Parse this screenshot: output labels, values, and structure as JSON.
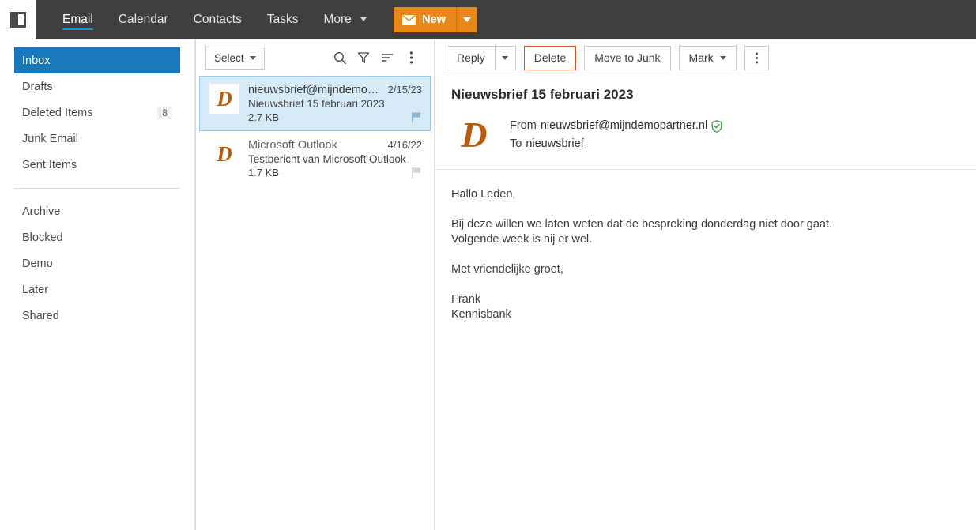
{
  "topbar": {
    "toggle_name": "sidebar-toggle",
    "nav_items": [
      {
        "label": "Email",
        "active": true,
        "has_caret": false
      },
      {
        "label": "Calendar",
        "active": false,
        "has_caret": false
      },
      {
        "label": "Contacts",
        "active": false,
        "has_caret": false
      },
      {
        "label": "Tasks",
        "active": false,
        "has_caret": false
      },
      {
        "label": "More",
        "active": false,
        "has_caret": true
      }
    ],
    "new_button": {
      "label": "New",
      "icon": "envelope-icon",
      "color": "#e8881a"
    }
  },
  "sidebar": {
    "folders": [
      {
        "label": "Inbox",
        "count": "",
        "selected": true
      },
      {
        "label": "Drafts",
        "count": "",
        "selected": false
      },
      {
        "label": "Deleted Items",
        "count": "8",
        "selected": false
      },
      {
        "label": "Junk Email",
        "count": "",
        "selected": false
      },
      {
        "label": "Sent Items",
        "count": "",
        "selected": false
      }
    ],
    "tags": [
      {
        "label": "Archive"
      },
      {
        "label": "Blocked"
      },
      {
        "label": "Demo"
      },
      {
        "label": "Later"
      },
      {
        "label": "Shared"
      }
    ],
    "selected_color": "#1878b9"
  },
  "message_list": {
    "toolbar": {
      "select_label": "Select",
      "icons": [
        "search-icon",
        "filter-icon",
        "sort-icon",
        "more-options-icon"
      ]
    },
    "messages": [
      {
        "avatar_letter": "D",
        "sender": "nieuwsbrief@mijndemop…",
        "date": "2/15/23",
        "subject": "Nieuwsbrief 15 februari 2023",
        "size": "2.7 KB",
        "selected": true,
        "flagged": false
      },
      {
        "avatar_letter": "D",
        "sender": "Microsoft Outlook",
        "date": "4/16/22",
        "subject": "Testbericht van Microsoft Outlook",
        "size": "1.7 KB",
        "selected": false,
        "flagged": false
      }
    ]
  },
  "reading_pane": {
    "toolbar": {
      "reply_label": "Reply",
      "delete_label": "Delete",
      "delete_border_color": "#d94f23",
      "move_to_junk_label": "Move to Junk",
      "mark_label": "Mark"
    },
    "subject": "Nieuwsbrief 15 februari 2023",
    "avatar_letter": "D",
    "from_label": "From",
    "from_address": "nieuwsbrief@mijndemopartner.nl",
    "verified_icon": "verified-shield-icon",
    "verified_color": "#3a9e3a",
    "to_label": "To",
    "to_address": "nieuwsbrief",
    "body": {
      "greeting": "Hallo Leden,",
      "paragraph_line1": "Bij deze willen we laten weten dat de bespreking donderdag niet door gaat.",
      "paragraph_line2": "Volgende week is hij er wel.",
      "closing": "Met vriendelijke groet,",
      "signature_name": "Frank",
      "signature_org": "Kennisbank"
    }
  }
}
